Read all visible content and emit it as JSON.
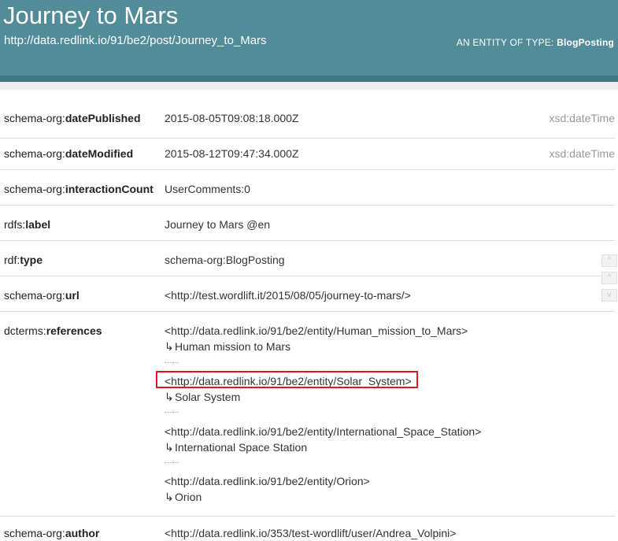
{
  "header": {
    "title": "Journey to Mars",
    "uri": "http://data.redlink.io/91/be2/post/Journey_to_Mars",
    "type_prefix": "AN ENTITY OF TYPE:",
    "type_name": "BlogPosting"
  },
  "rows": [
    {
      "prefix": "schema-org:",
      "name": "datePublished",
      "value": "2015-08-05T09:08:18.000Z",
      "datatype": "xsd:dateTime"
    },
    {
      "prefix": "schema-org:",
      "name": "dateModified",
      "value": "2015-08-12T09:47:34.000Z",
      "datatype": "xsd:dateTime"
    },
    {
      "prefix": "schema-org:",
      "name": "interactionCount",
      "value": "UserComments:0"
    },
    {
      "prefix": "rdfs:",
      "name": "label",
      "value": "Journey to Mars @en"
    },
    {
      "prefix": "rdf:",
      "name": "type",
      "value": "schema-org:BlogPosting"
    },
    {
      "prefix": "schema-org:",
      "name": "url",
      "value": "<http://test.wordlift.it/2015/08/05/journey-to-mars/>"
    }
  ],
  "references": {
    "prefix": "dcterms:",
    "name": "references",
    "items": [
      {
        "uri": "<http://data.redlink.io/91/be2/entity/Human_mission_to_Mars>",
        "label": "Human mission to Mars"
      },
      {
        "uri": "<http://data.redlink.io/91/be2/entity/Solar_System>",
        "label": "Solar System"
      },
      {
        "uri": "<http://data.redlink.io/91/be2/entity/International_Space_Station>",
        "label": "International Space Station"
      },
      {
        "uri": "<http://data.redlink.io/91/be2/entity/Orion>",
        "label": "Orion"
      }
    ]
  },
  "author": {
    "prefix": "schema-org:",
    "name": "author",
    "value": "<http://data.redlink.io/353/test-wordlift/user/Andrea_Volpini>"
  },
  "glyphs": {
    "return_arrow": "↳",
    "scroll_up": "^",
    "scroll_down": "v"
  },
  "colors": {
    "header": "#528c99",
    "header_strip": "#437883",
    "highlight": "#e0191f",
    "datatype": "#999999"
  }
}
